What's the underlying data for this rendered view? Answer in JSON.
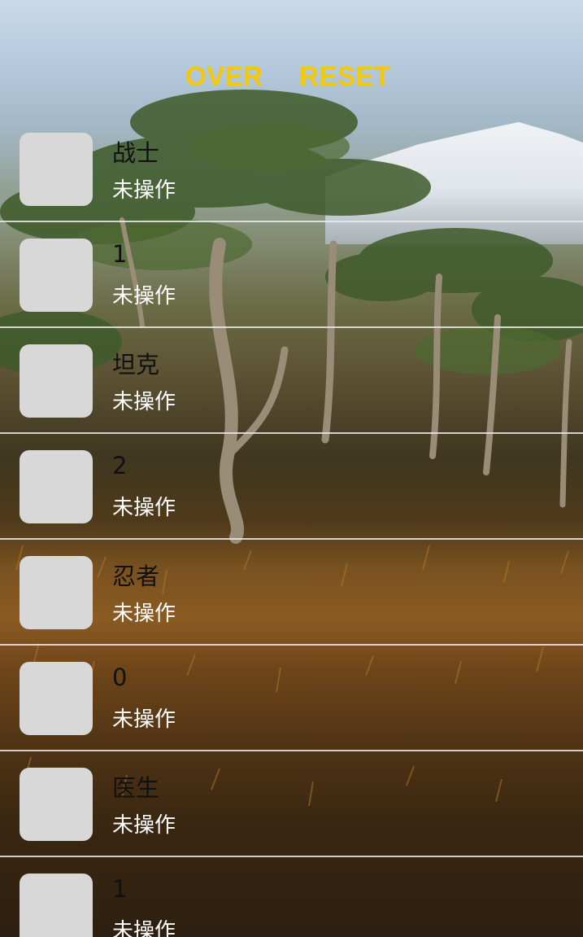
{
  "toolbar": {
    "over_label": "OVER",
    "reset_label": "RESET",
    "accent_color": "#f5c800"
  },
  "list": {
    "items": [
      {
        "name": "战士",
        "status": "未操作"
      },
      {
        "name": "1",
        "status": "未操作"
      },
      {
        "name": "坦克",
        "status": "未操作"
      },
      {
        "name": "2",
        "status": "未操作"
      },
      {
        "name": "忍者",
        "status": "未操作"
      },
      {
        "name": "0",
        "status": "未操作"
      },
      {
        "name": "医生",
        "status": "未操作"
      },
      {
        "name": "1",
        "status": "未操作"
      }
    ]
  },
  "colors": {
    "avatar_placeholder": "#d8d8d8",
    "divider": "#ebebeb",
    "name_text": "#111111",
    "status_text": "#ffffff"
  }
}
